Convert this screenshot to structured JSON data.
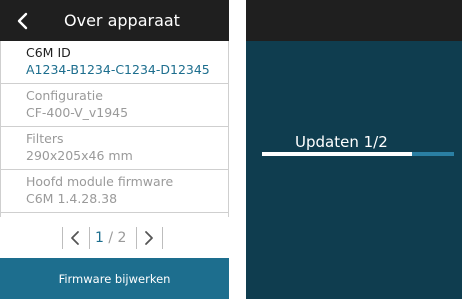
{
  "left_panel": {
    "header": {
      "title": "Over apparaat",
      "back_icon": "chevron-left-icon"
    },
    "rows": [
      {
        "label": "C6M ID",
        "value": "A1234-B1234-C1234-D12345",
        "active": true
      },
      {
        "label": "Configuratie",
        "value": "CF-400-V_v1945",
        "active": false
      },
      {
        "label": "Filters",
        "value": "290x205x46 mm",
        "active": false
      },
      {
        "label": "Hoofd module firmware",
        "value": "C6M 1.4.28.38",
        "active": false
      }
    ],
    "pager": {
      "current": "1",
      "separator": "/",
      "total": "2",
      "prev_icon": "chevron-left-icon",
      "next_icon": "chevron-right-icon"
    },
    "button": {
      "label": "Firmware bijwerken"
    }
  },
  "right_panel": {
    "update_title": "Updaten 1/2",
    "progress": 0.78
  },
  "colors": {
    "header": "#1f1f1f",
    "accent": "#1d6e8e",
    "right_background": "#0f3d4f",
    "progress_track": "#2a7fa3",
    "muted_text": "#9a9a9a"
  }
}
